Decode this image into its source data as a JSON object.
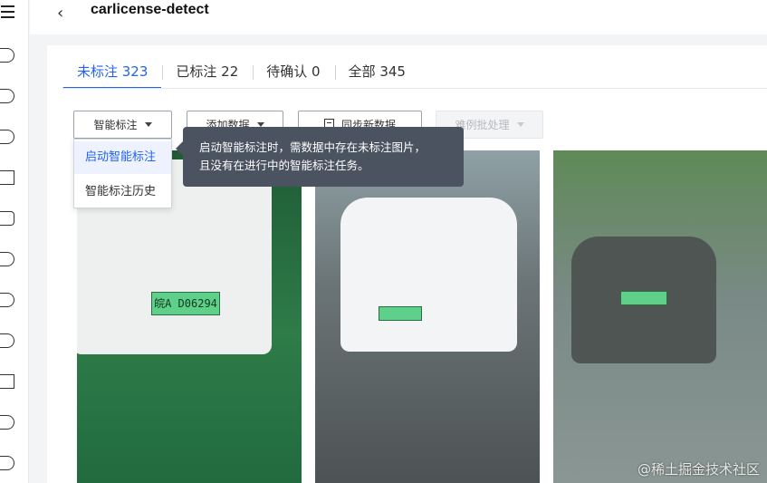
{
  "app": {
    "title": "carlicense-detect"
  },
  "tabs": [
    {
      "label": "未标注 323"
    },
    {
      "label": "已标注 22"
    },
    {
      "label": "待确认 0"
    },
    {
      "label": "全部 345"
    }
  ],
  "toolbar": {
    "smart_label": "智能标注",
    "add_data": "添加数据",
    "sync_data": "同步新数据",
    "batch": "难例批处理"
  },
  "dropdown": {
    "items": [
      {
        "label": "启动智能标注"
      },
      {
        "label": "智能标注历史"
      }
    ]
  },
  "tooltip": {
    "line1": "启动智能标注时，需数据中存在未标注图片，",
    "line2": "且没有在进行中的智能标注任务。"
  },
  "images": [
    {
      "plate": "皖A D06294"
    },
    {
      "plate": ""
    },
    {
      "plate": ""
    }
  ],
  "watermark": "@稀土掘金技术社区",
  "colors": {
    "accent": "#2563eb",
    "tooltip_bg": "#4b5260"
  },
  "icons": [
    "menu-icon",
    "back-arrow-icon",
    "caret-down-icon",
    "document-icon",
    "cloud-icon"
  ]
}
